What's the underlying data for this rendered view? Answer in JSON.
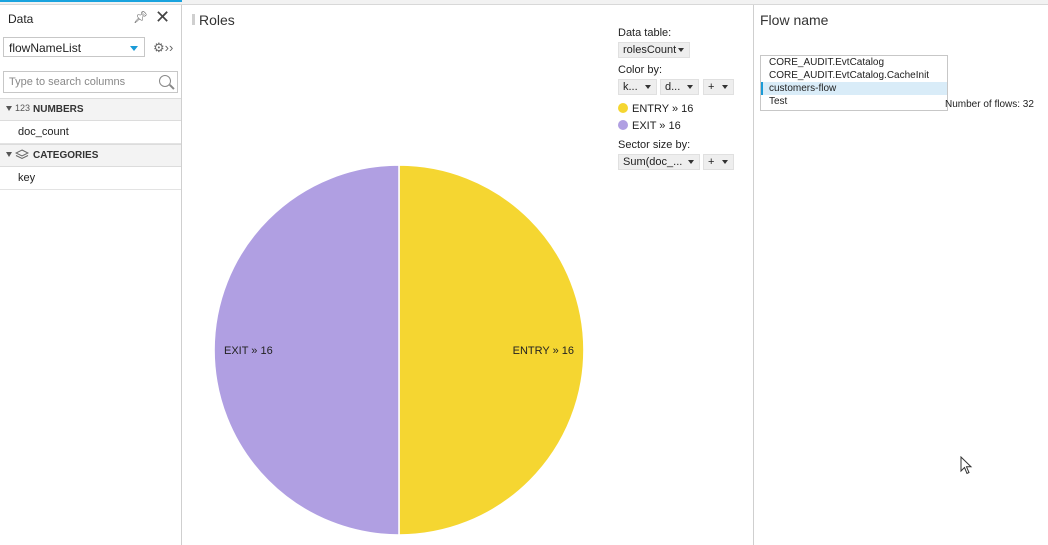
{
  "left_panel": {
    "title": "Data",
    "dataset": "flowNameList",
    "search_placeholder": "Type to search columns",
    "numbers_section": "NUMBERS",
    "numbers_icon": "123",
    "number_fields": [
      "doc_count"
    ],
    "categories_section": "CATEGORIES",
    "category_fields": [
      "key"
    ]
  },
  "roles_panel": {
    "title": "Roles",
    "data_table_label": "Data table:",
    "data_table_value": "rolesCount",
    "color_by_label": "Color by:",
    "color_by_dropdown_1": "k...",
    "color_by_dropdown_2": "d...",
    "add_label": "+",
    "sector_size_label": "Sector size by:",
    "sector_size_value": "Sum(doc_...",
    "legend": [
      {
        "label": "ENTRY » 16",
        "color": "#f5d631"
      },
      {
        "label": "EXIT » 16",
        "color": "#b09fe2"
      }
    ]
  },
  "chart_data": {
    "type": "pie",
    "categories": [
      "ENTRY",
      "EXIT"
    ],
    "values": [
      16,
      16
    ],
    "slice_labels": [
      "ENTRY » 16",
      "EXIT » 16"
    ],
    "colors": [
      "#f5d631",
      "#b09fe2"
    ]
  },
  "flow_panel": {
    "title": "Flow name",
    "items": [
      "CORE_AUDIT.EvtCatalog",
      "CORE_AUDIT.EvtCatalog.CacheInit",
      "customers-flow",
      "Test"
    ],
    "selected_index": 2,
    "count_text": "Number of flows: 32"
  }
}
